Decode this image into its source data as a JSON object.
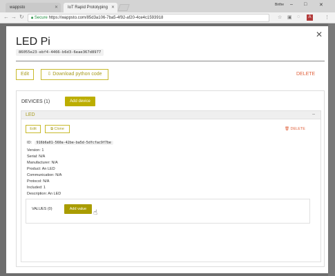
{
  "browser": {
    "tabs": [
      {
        "label": "wappsto",
        "active": false
      },
      {
        "label": "IoT Rapid Prototyping",
        "active": true
      }
    ],
    "user": "Birthe",
    "address": {
      "secure_label": "Secure",
      "url": "https://wappsto.com/85d3a106-7ba5-4f92-af20-4ce4c1593918"
    }
  },
  "modal": {
    "title": "LED Pi",
    "id": "86055e23-ebf4-4466-b6d3-6eae367d8977",
    "edit_label": "Edit",
    "download_label": "Download python code",
    "delete_label": "DELETE"
  },
  "devices": {
    "label": "DEVICES (1)",
    "add_label": "Add device",
    "items": [
      {
        "name": "LED",
        "edit_label": "Edit",
        "clone_label": "Clone",
        "delete_label": "DELETE",
        "id_label": "ID:",
        "id": "916b6a01-560a-42be-ba5d-5dfcfac9f7be",
        "fields": [
          "Version: 1",
          "Serial: N/A",
          "Manufacturer: N/A",
          "Product: An LED",
          "Communication: N/A",
          "Protocol: N/A",
          "Included: 1",
          "Description: An LED"
        ],
        "values_label": "VALUES (0)",
        "add_value_label": "Add value"
      }
    ]
  },
  "colors": {
    "accent": "#bcae00",
    "danger": "#e0623d"
  }
}
